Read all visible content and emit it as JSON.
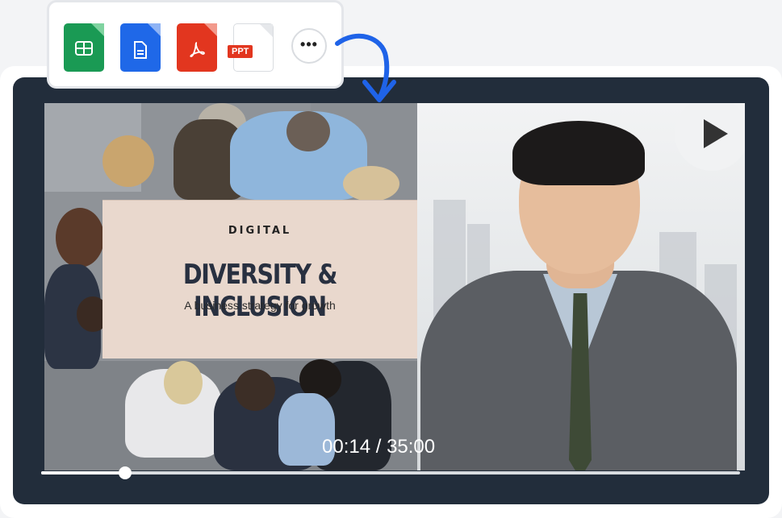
{
  "file_types": [
    {
      "name": "sheets",
      "color": "#1a9a54"
    },
    {
      "name": "docs",
      "color": "#1f68e8"
    },
    {
      "name": "pdf",
      "color": "#e2361f"
    },
    {
      "name": "ppt",
      "color": "#ffffff",
      "label": "PPT"
    }
  ],
  "more_button": {
    "icon": "more-icon"
  },
  "slide": {
    "brand": "DIGITAL",
    "title": "DIVERSITY & INCLUSION",
    "subtitle": "A business strategy for growth"
  },
  "player": {
    "time_display": "00:14 / 35:00",
    "progress_fraction": 0.12,
    "play_icon": "play-icon"
  },
  "colors": {
    "accent_arrow": "#1f63e8",
    "player_bg": "#222d3b"
  }
}
